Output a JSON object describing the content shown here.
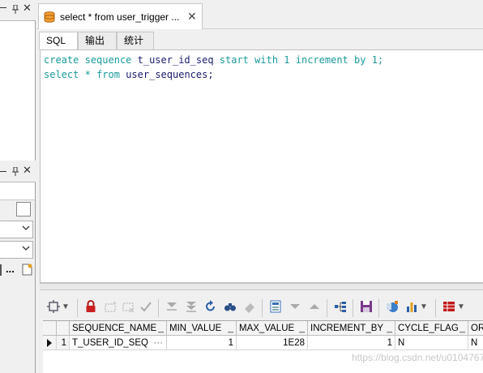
{
  "left_top_panel": {
    "header_icons": [
      "pin-icon",
      "close-icon"
    ]
  },
  "left_bottom_panel": {
    "header_icons": [
      "pin-icon",
      "close-icon"
    ],
    "more_label": "..."
  },
  "document_tab": {
    "title": "select * from user_trigger ...",
    "close": "✕"
  },
  "subtabs": [
    "SQL",
    "输出",
    "统计"
  ],
  "editor": {
    "line1": {
      "kw1": "create",
      "kw2": "sequence",
      "name": "t_user_id_seq",
      "kw3": "start",
      "kw4": "with",
      "n1": "1",
      "kw5": "increment",
      "kw6": "by",
      "n2": "1;"
    },
    "line2": {
      "kw1": "select",
      "star": "*",
      "kw2": "from",
      "table": "user_sequences;"
    }
  },
  "grid": {
    "columns": [
      "SEQUENCE_NAME",
      "MIN_VALUE",
      "MAX_VALUE",
      "INCREMENT_BY",
      "CYCLE_FLAG",
      "OR"
    ],
    "rows": [
      {
        "row_no": "1",
        "cells": [
          "T_USER_ID_SEQ",
          "1",
          "1E28",
          "1",
          "N",
          "N"
        ],
        "ellipsis": "···"
      }
    ]
  },
  "watermark": "https://blog.csdn.net/u010476739",
  "colors": {
    "keyword": "#1a9a9a",
    "identifier": "#1b1b6e",
    "accent": "#e07020"
  }
}
